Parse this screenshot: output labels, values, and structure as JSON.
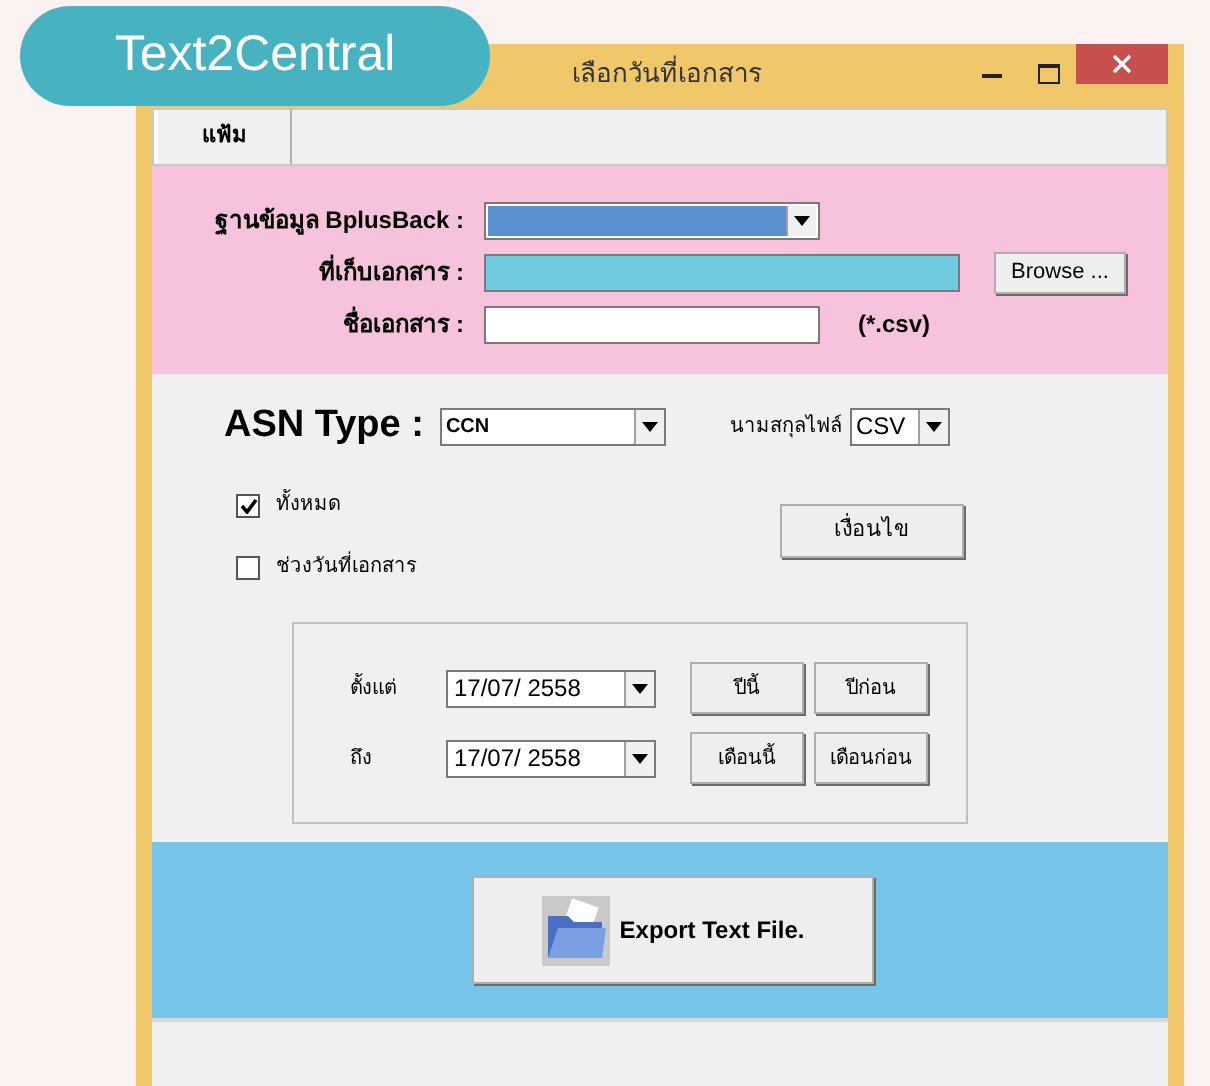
{
  "badge": {
    "text": "Text2Central"
  },
  "window": {
    "title": "เลือกวันที่เอกสาร"
  },
  "menu": [
    {
      "label": "แฟ้ม"
    }
  ],
  "source_fields": [
    {
      "kind": "select",
      "label": "ฐานข้อมูล BplusBack :"
    },
    {
      "kind": "path",
      "label": "ที่เก็บเอกสาร :",
      "button": "Browse ..."
    },
    {
      "kind": "text",
      "label": "ชื่อเอกสาร :",
      "suffix": "(*.csv)"
    }
  ],
  "asn_type": {
    "label": "ASN Type :",
    "value": "CCN"
  },
  "extension": {
    "label": "นามสกุลไฟล์",
    "value": "CSV"
  },
  "options": [
    {
      "label": "ทั้งหมด",
      "checked": true
    },
    {
      "label": "ช่วงวันที่เอกสาร",
      "checked": false
    }
  ],
  "condition_button": "เงื่อนไข",
  "date_rows": [
    {
      "label": "ตั้งแต่",
      "value": "17/07/ 2558",
      "buttons": [
        "ปีนี้",
        "ปีก่อน"
      ]
    },
    {
      "label": "ถึง",
      "value": "17/07/ 2558",
      "buttons": [
        "เดือนนี้",
        "เดือนก่อน"
      ]
    }
  ],
  "export_button": "Export Text File."
}
